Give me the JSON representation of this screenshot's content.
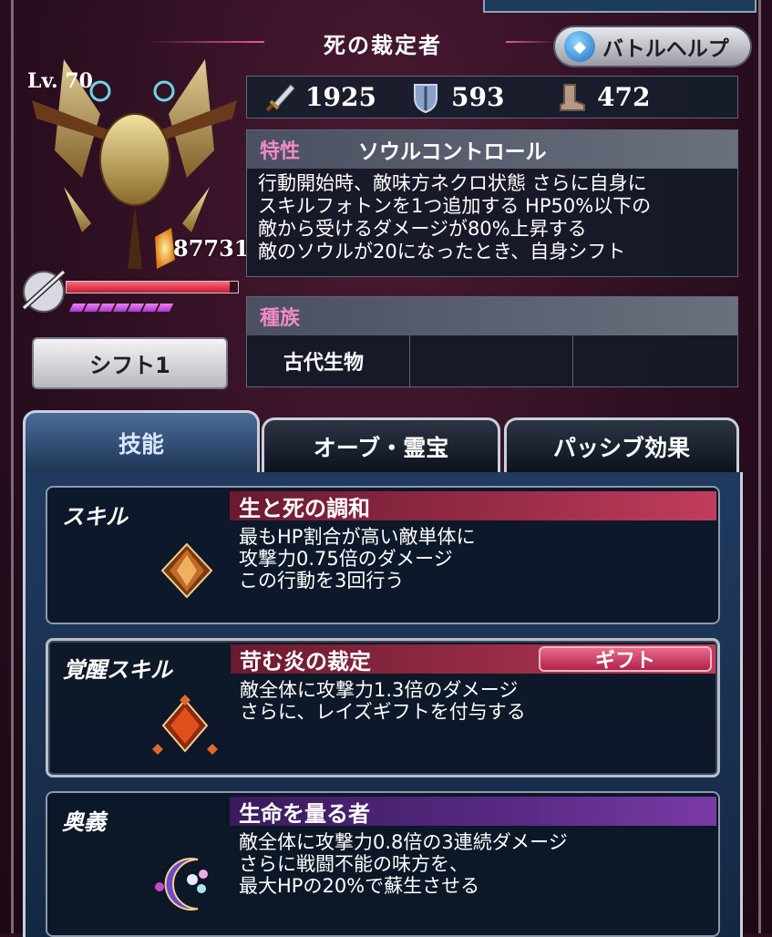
{
  "header": {
    "title": "死の裁定者",
    "help_button_label": "バトルヘルプ"
  },
  "unit": {
    "level_text": "Lv. 70",
    "hp": "87731",
    "hp_fraction": 0.95,
    "soul_pips": 7,
    "shift_button_label": "シフト1"
  },
  "stats": {
    "attack": "1925",
    "defense": "593",
    "speed": "472"
  },
  "trait": {
    "label": "特性",
    "name": "ソウルコントロール",
    "lines": [
      "行動開始時、敵味方ネクロ状態 さらに自身に",
      "スキルフォトンを1つ追加する HP50%以下の",
      "敵から受けるダメージが80%上昇する",
      "敵のソウルが20になったとき、自身シフト"
    ]
  },
  "race": {
    "label": "種族",
    "values": [
      "古代生物",
      "",
      ""
    ]
  },
  "tabs": [
    {
      "label": "技能",
      "active": true
    },
    {
      "label": "オーブ・霊宝",
      "active": false
    },
    {
      "label": "パッシブ効果",
      "active": false
    }
  ],
  "skills": [
    {
      "type": "スキル",
      "name": "生と死の調和",
      "lines": [
        "最もHP割合が高い敵単体に",
        "攻撃力0.75倍のダメージ",
        "この行動を3回行う"
      ]
    },
    {
      "type": "覚醒スキル",
      "name": "苛む炎の裁定",
      "badge": "ギフト",
      "lines": [
        "敵全体に攻撃力1.3倍のダメージ",
        "さらに、レイズギフトを付与する"
      ]
    },
    {
      "type": "奥義",
      "name": "生命を量る者",
      "lines": [
        "敵全体に攻撃力0.8倍の3連続ダメージ",
        "さらに戦闘不能の味方を、",
        "最大HPの20%で蘇生させる"
      ]
    }
  ],
  "colors": {
    "accent_pink": "#f08ac8",
    "skill_bar_red": "#9c2d4a",
    "skill_bar_purple": "#5a2a86",
    "panel_blue": "#203a60"
  }
}
